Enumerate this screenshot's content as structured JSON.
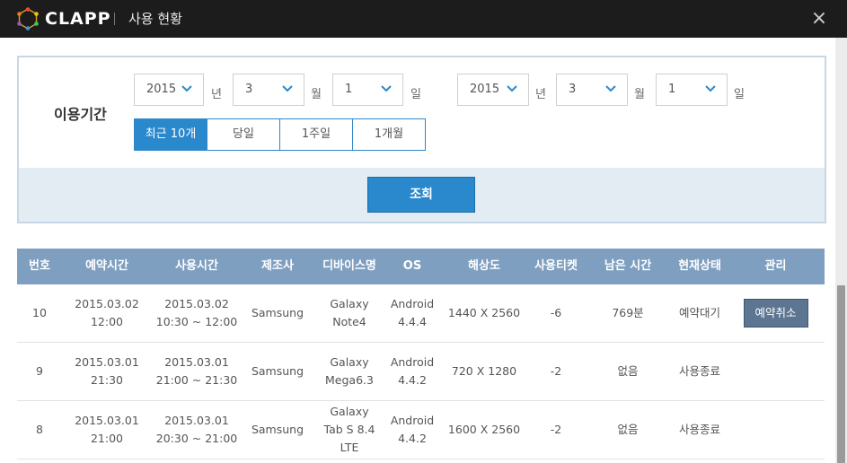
{
  "window": {
    "brand": "CLAPP",
    "title": "사용 현황",
    "close_label": "×",
    "colors": {
      "titlebar": "#1c1c1c",
      "accent": "#2a88cc",
      "table_header": "#7f9fc0",
      "cancel_button": "#5c7591"
    }
  },
  "filter": {
    "period_label": "이용기간",
    "start": {
      "year": "2015",
      "month": "3",
      "day": "1"
    },
    "end": {
      "year": "2015",
      "month": "3",
      "day": "1"
    },
    "units": {
      "year": "년",
      "month": "월",
      "day": "일"
    },
    "quick_ranges": [
      {
        "label": "최근 10개",
        "active": true
      },
      {
        "label": "당일",
        "active": false
      },
      {
        "label": "1주일",
        "active": false
      },
      {
        "label": "1개월",
        "active": false
      }
    ],
    "search_label": "조회"
  },
  "table": {
    "columns": [
      "번호",
      "예약시간",
      "사용시간",
      "제조사",
      "디바이스명",
      "OS",
      "해상도",
      "사용티켓",
      "남은 시간",
      "현재상태",
      "관리"
    ],
    "rows": [
      {
        "no": "10",
        "reserve": [
          "2015.03.02",
          "12:00"
        ],
        "use": [
          "2015.03.02",
          "10:30 ~ 12:00"
        ],
        "maker": "Samsung",
        "device": [
          "Galaxy",
          "Note4"
        ],
        "os": [
          "Android",
          "4.4.4"
        ],
        "resolution": "1440 X 2560",
        "ticket": "-6",
        "remaining": "769분",
        "status": "예약대기",
        "action": "예약취소"
      },
      {
        "no": "9",
        "reserve": [
          "2015.03.01",
          "21:30"
        ],
        "use": [
          "2015.03.01",
          "21:00 ~ 21:30"
        ],
        "maker": "Samsung",
        "device": [
          "Galaxy",
          "Mega6.3"
        ],
        "os": [
          "Android",
          "4.4.2"
        ],
        "resolution": "720 X 1280",
        "ticket": "-2",
        "remaining": "없음",
        "status": "사용종료",
        "action": ""
      },
      {
        "no": "8",
        "reserve": [
          "2015.03.01",
          "21:00"
        ],
        "use": [
          "2015.03.01",
          "20:30 ~ 21:00"
        ],
        "maker": "Samsung",
        "device": [
          "Galaxy",
          "Tab S 8.4 LTE"
        ],
        "os": [
          "Android",
          "4.4.2"
        ],
        "resolution": "1600 X 2560",
        "ticket": "-2",
        "remaining": "없음",
        "status": "사용종료",
        "action": ""
      }
    ]
  }
}
